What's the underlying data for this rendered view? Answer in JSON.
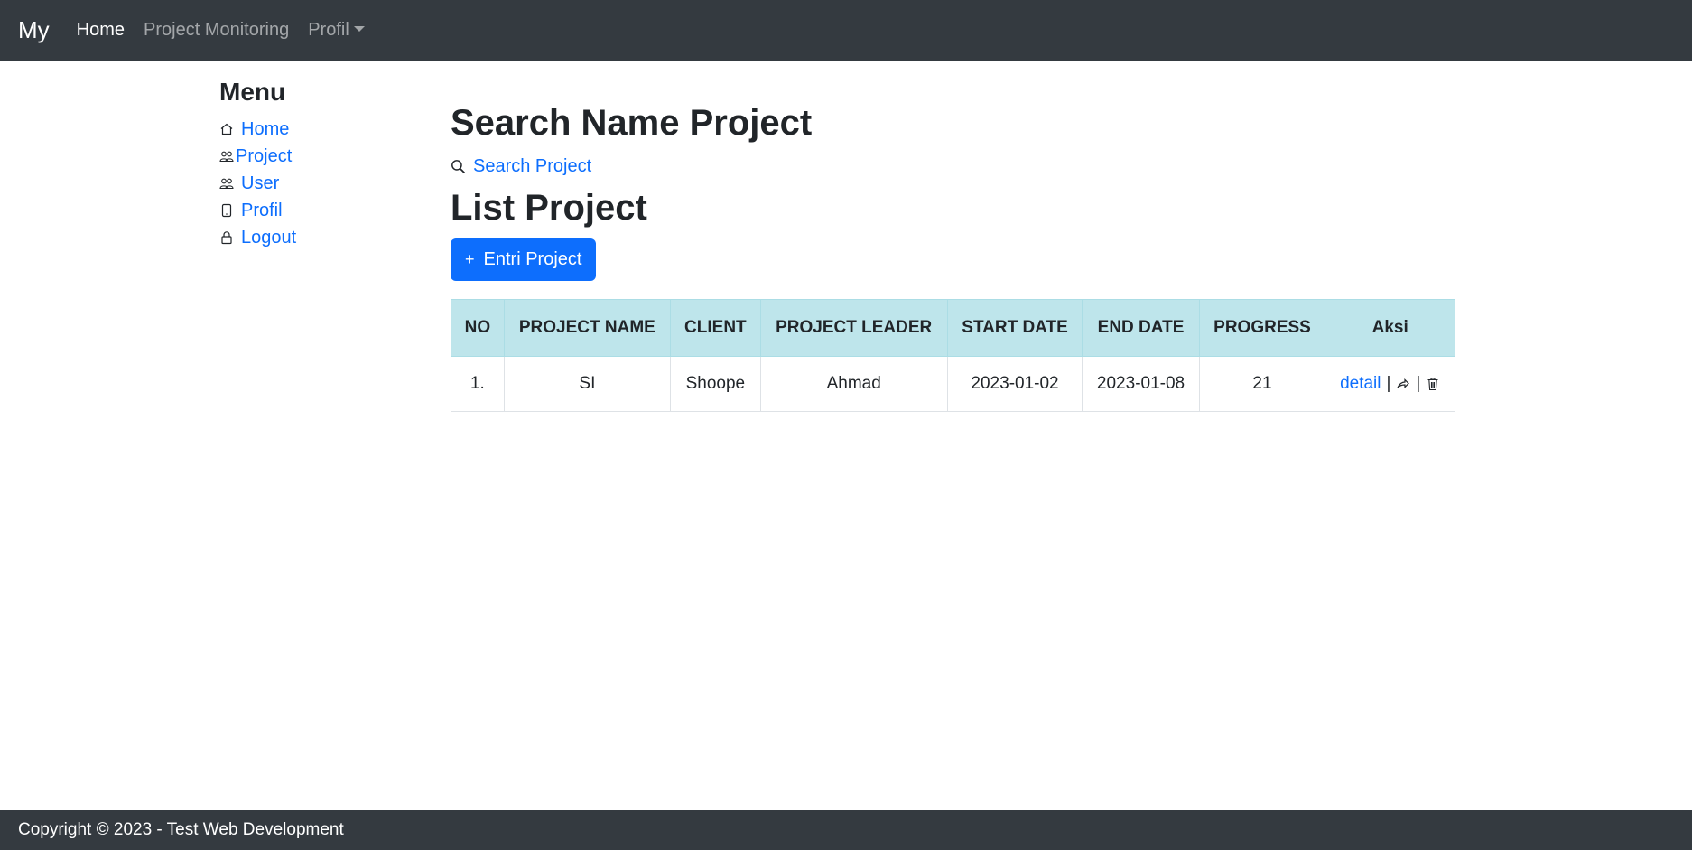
{
  "navbar": {
    "brand": "My",
    "links": [
      "Home",
      "Project Monitoring"
    ],
    "dropdown": "Profil"
  },
  "sidebar": {
    "title": "Menu",
    "items": [
      {
        "label": "Home",
        "icon": "home-icon"
      },
      {
        "label": "Project",
        "icon": "people-icon"
      },
      {
        "label": "User",
        "icon": "people-icon"
      },
      {
        "label": "Profil",
        "icon": "phone-icon"
      },
      {
        "label": "Logout",
        "icon": "lock-icon"
      }
    ]
  },
  "main": {
    "search_heading": "Search Name Project",
    "search_link": "Search Project",
    "list_heading": "List Project",
    "add_button": "Entri Project"
  },
  "table": {
    "headers": [
      "NO",
      "PROJECT NAME",
      "CLIENT",
      "PROJECT LEADER",
      "START DATE",
      "END DATE",
      "PROGRESS",
      "Aksi"
    ],
    "rows": [
      {
        "no": "1.",
        "name": "SI",
        "client": "Shoope",
        "leader": "Ahmad",
        "start": "2023-01-02",
        "end": "2023-01-08",
        "progress": "21",
        "detail": "detail",
        "sep": "|"
      }
    ]
  },
  "footer": {
    "text": "Copyright © 2023 - Test Web Development"
  },
  "colors": {
    "navbar": "#343a40",
    "primary": "#0d6efd",
    "header_bg": "#bee5eb"
  }
}
